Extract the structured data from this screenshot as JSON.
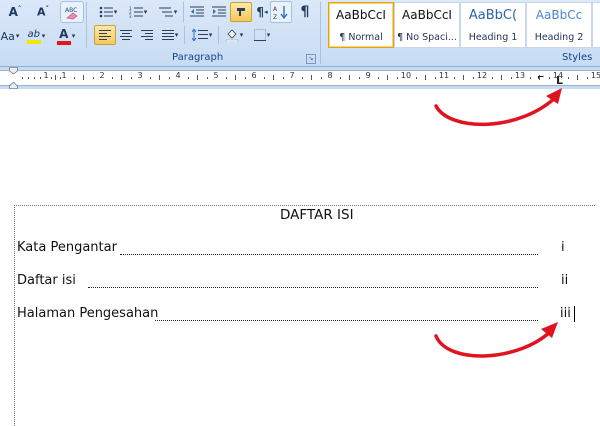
{
  "ribbon": {
    "font_tools": {
      "grow_font_icon": "A˄",
      "shrink_font_icon": "A˅",
      "clear_format_icon": "ABC eraser",
      "font_dd_partial": "Aa",
      "highlight_label": "ab",
      "font_color_label": "A",
      "highlight_color": "#f5e600",
      "font_color_color": "#e01818"
    },
    "paragraph": {
      "group_label": "Paragraph",
      "show_marks_label": "¶",
      "sort_label": "A↓Z"
    },
    "styles": {
      "group_label": "Styles",
      "items": [
        {
          "sample": "AaBbCcI",
          "name": "¶ Normal",
          "selected": true,
          "color": "#111111"
        },
        {
          "sample": "AaBbCcI",
          "name": "¶ No Spaci...",
          "selected": false,
          "color": "#111111"
        },
        {
          "sample": "AaBbC(",
          "name": "Heading 1",
          "selected": false,
          "color": "#2e64a8"
        },
        {
          "sample": "AaBbCc",
          "name": "Heading 2",
          "selected": false,
          "color": "#4a86cf"
        }
      ]
    }
  },
  "ruler": {
    "numbers": [
      "1",
      "1",
      "2",
      "3",
      "4",
      "5",
      "6",
      "7",
      "8",
      "9",
      "10",
      "11",
      "12",
      "13",
      "14",
      "15"
    ],
    "tab_stop_symbol": "L"
  },
  "document": {
    "title": "DAFTAR ISI",
    "entries": [
      {
        "label": "Kata Pengantar",
        "page": "i"
      },
      {
        "label": "Daftar isi",
        "page": "ii"
      },
      {
        "label": "Halaman Pengesahan",
        "page": "iii"
      }
    ]
  },
  "annotations": {
    "arrow_color": "#e0141e"
  }
}
